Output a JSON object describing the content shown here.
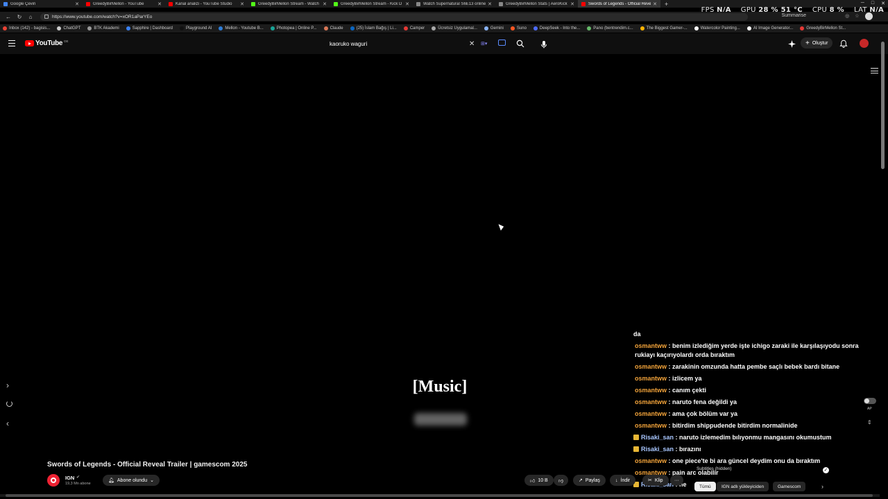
{
  "browser": {
    "tabs": [
      {
        "title": "Google Çeviri",
        "color": "#4285f4",
        "active": false
      },
      {
        "title": "GreedyBirMellon - YouTube",
        "color": "#ff0000",
        "active": false
      },
      {
        "title": "Kanal analizi - YouTube Studio",
        "color": "#ff0000",
        "active": false
      },
      {
        "title": "GreedyBirMellon Stream - Watch",
        "color": "#53fc18",
        "active": false
      },
      {
        "title": "GreedyBirMellon Stream - Kick D",
        "color": "#53fc18",
        "active": false
      },
      {
        "title": "Watch Supernatural S6E13 online",
        "color": "#888888",
        "active": false
      },
      {
        "title": "GreedyBirMellon Stats | AeroKick",
        "color": "#888888",
        "active": false
      },
      {
        "title": "Swords of Legends - Official Reve",
        "color": "#ff0000",
        "active": true
      }
    ],
    "new_tab": "+",
    "url": "https://www.youtube.com/watch?v=xOR1aParYEo",
    "summarise": "Summarise",
    "bookmarks": [
      {
        "label": "Inbox (142) - bagisis...",
        "color": "#ea4335"
      },
      {
        "label": "ChatGPT",
        "color": "#cccccc"
      },
      {
        "label": "BTK Akademi",
        "color": "#999999"
      },
      {
        "label": "Sapphire | Dashboard",
        "color": "#3b82f6"
      },
      {
        "label": "Playground AI",
        "color": "#111111"
      },
      {
        "label": "Mellon - Youtube B...",
        "color": "#2e7dd7"
      },
      {
        "label": "Photopea | Online P...",
        "color": "#18a497"
      },
      {
        "label": "Claude",
        "color": "#d97757"
      },
      {
        "label": "(25) İslam Bağış | Li...",
        "color": "#0a66c2"
      },
      {
        "label": "Camper",
        "color": "#e53935"
      },
      {
        "label": "Ücretsiz Uygulamal...",
        "color": "#aaaaaa"
      },
      {
        "label": "Gemini",
        "color": "#8ab4f8"
      },
      {
        "label": "Suno",
        "color": "#ff5722"
      },
      {
        "label": "DeepSeek - Into the...",
        "color": "#4d6bfe"
      },
      {
        "label": "Pano (bentrendim.c...",
        "color": "#66bb6a"
      },
      {
        "label": "The Biggest Gamer-...",
        "color": "#ffb300"
      },
      {
        "label": "Watercolor Painting...",
        "color": "#ffffff"
      },
      {
        "label": "AI Image Generator...",
        "color": "#ffffff"
      },
      {
        "label": "GreedyBirMellon St...",
        "color": "#e53935"
      }
    ]
  },
  "hud": {
    "fps_label": "FPS",
    "fps_value": "N/A",
    "gpu_label": "GPU",
    "gpu_value": "28 % 51 °C",
    "cpu_label": "CPU",
    "cpu_value": "8 %",
    "lat_label": "LAT",
    "lat_value": "N/A"
  },
  "youtube": {
    "logo_text": "YouTube",
    "country_code": "DE",
    "search_value": "kaoruko waguri",
    "create_label": "Oluştur"
  },
  "player": {
    "caption": "[Music]"
  },
  "chat": [
    {
      "user": "",
      "text": "da",
      "badge": false
    },
    {
      "user": "osmantww",
      "text": " : benim izlediğim yerde işte ichigo zaraki ile karşılaşıyodu sonra rukiayı kaçırıyolardı orda bıraktım",
      "badge": false
    },
    {
      "user": "osmantww",
      "text": " : zarakinin omzunda hatta pembe saçlı bebek bardı bitane",
      "badge": false
    },
    {
      "user": "osmantww",
      "text": " : izlicem ya",
      "badge": false
    },
    {
      "user": "osmantww",
      "text": " : canım çekti",
      "badge": false
    },
    {
      "user": "osmantww",
      "text": " : naruto fena değildi ya",
      "badge": false
    },
    {
      "user": "osmantww",
      "text": " : ama çok bölüm var ya",
      "badge": false
    },
    {
      "user": "osmantww",
      "text": " : bitirdim shippudende bitirdim normalinide",
      "badge": false
    },
    {
      "user": "Risaki_san",
      "text": " : naruto izlemedim bılıyonmu mangasını okumustum",
      "badge": true
    },
    {
      "user": "Risaki_san",
      "text": " : bırazını",
      "badge": true
    },
    {
      "user": "osmantww",
      "text": " : one piece'te bi ara güncel deydim onu da bıraktım",
      "badge": false
    },
    {
      "user": "osmantww",
      "text": " : pain arc olabilir",
      "badge": false
    },
    {
      "user": "Risaki_san",
      "text": " : ne",
      "badge": true
    }
  ],
  "subtitles_hidden": "Subtitles (hidden)",
  "autoplay_label": "AP",
  "video": {
    "title": "Swords of Legends - Official Reveal Trailer | gamescom 2025",
    "channel": "IGN",
    "subscribers": "19,3 Mn abone",
    "subscribe_label": "Abone olundu",
    "likes": "10 B",
    "share_label": "Paylaş",
    "download_label": "İndir",
    "clip_label": "Klip",
    "more_label": "···"
  },
  "filters": [
    "Tümü",
    "IGN adlı yükleyiciden",
    "Gamescom"
  ]
}
